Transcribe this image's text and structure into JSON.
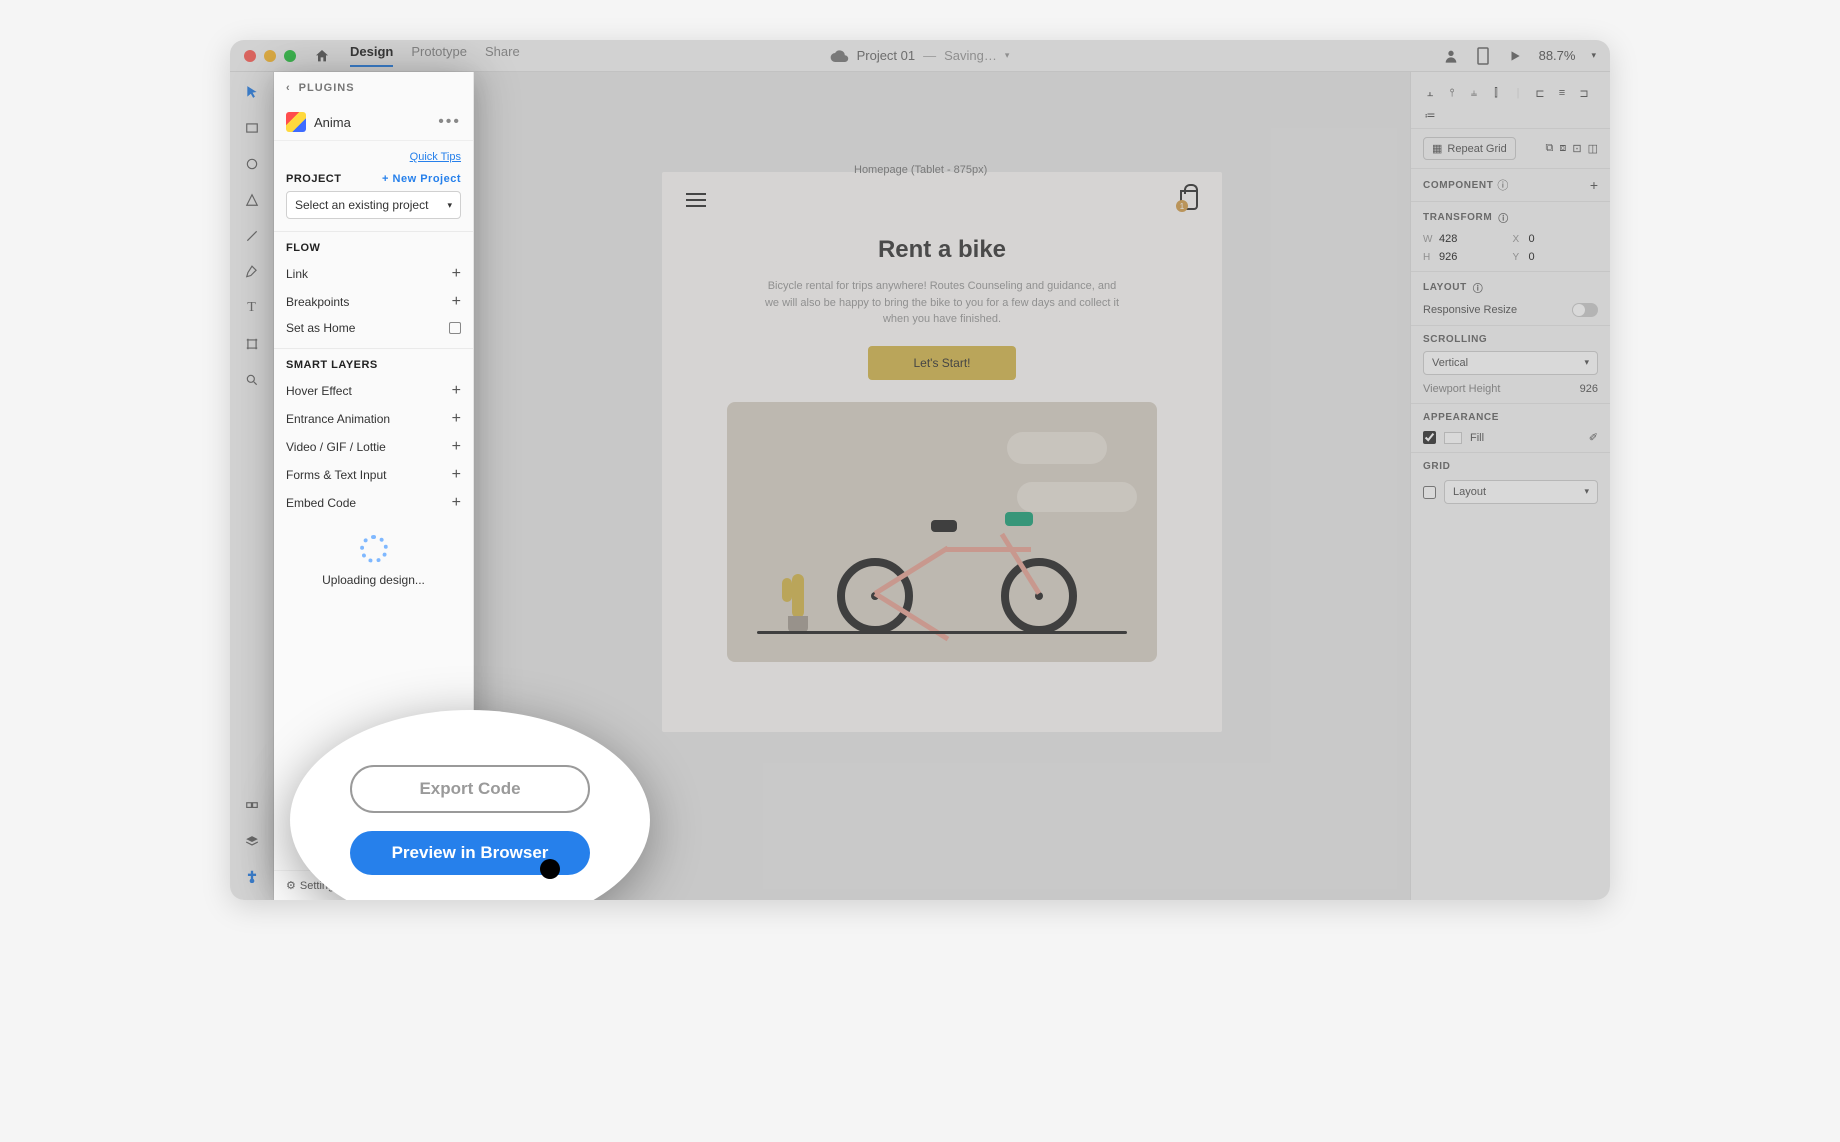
{
  "topbar": {
    "tabs": [
      "Design",
      "Prototype",
      "Share"
    ],
    "project_name": "Project 01",
    "save_status": "Saving…",
    "zoom": "88.7%"
  },
  "plugin": {
    "header": "PLUGINS",
    "name": "Anima",
    "quick_tips": "Quick Tips",
    "project_label": "PROJECT",
    "new_project": "+ New Project",
    "select_placeholder": "Select an existing project",
    "flow_label": "FLOW",
    "flow_items": {
      "link": "Link",
      "breakpoints": "Breakpoints",
      "set_home": "Set as Home"
    },
    "smart_label": "SMART LAYERS",
    "smart_items": {
      "hover": "Hover Effect",
      "entrance": "Entrance Animation",
      "video": "Video / GIF / Lottie",
      "forms": "Forms & Text Input",
      "embed": "Embed Code"
    },
    "uploading": "Uploading design...",
    "settings": "Settings"
  },
  "callout": {
    "export": "Export Code",
    "preview": "Preview in Browser"
  },
  "canvas": {
    "artboard_label": "Homepage (Tablet - 875px)",
    "hero_title": "Rent a bike",
    "hero_sub": "Bicycle rental for trips anywhere! Routes Counseling and guidance, and we will also be happy to bring the bike to you for a few days and collect it when you have finished.",
    "cta": "Let's Start!",
    "bag_count": "1"
  },
  "inspector": {
    "repeat_grid": "Repeat Grid",
    "component_label": "COMPONENT",
    "transform_label": "TRANSFORM",
    "w": "428",
    "x": "0",
    "h": "926",
    "y": "0",
    "layout_label": "LAYOUT",
    "responsive": "Responsive Resize",
    "scrolling_label": "SCROLLING",
    "scrolling_value": "Vertical",
    "viewport_label": "Viewport Height",
    "viewport_value": "926",
    "appearance_label": "APPEARANCE",
    "fill_label": "Fill",
    "grid_label": "GRID",
    "grid_value": "Layout"
  }
}
